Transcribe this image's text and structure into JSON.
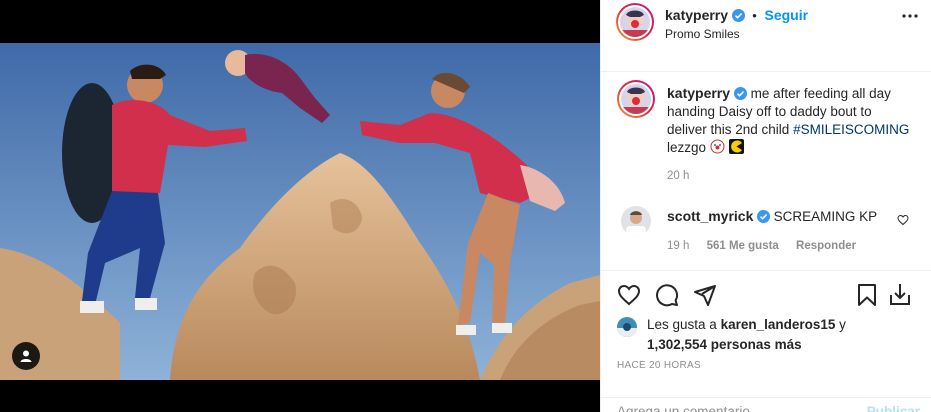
{
  "post": {
    "author": "katyperry",
    "follow_label": "Seguir",
    "dot": "•",
    "location": "Promo Smiles"
  },
  "caption": {
    "author": "katyperry",
    "text_before": "me after feeding all day handing Daisy off to daddy bout to deliver this 2nd child",
    "hashtag": "#SMILEISCOMING",
    "text_after": "lezzgo",
    "time": "20 h"
  },
  "comment": {
    "author": "scott_myrick",
    "text": "SCREAMING KP",
    "time": "19 h",
    "likes": "561 Me gusta",
    "reply_label": "Responder"
  },
  "likes": {
    "prefix": "Les gusta a",
    "user": "karen_landeros15",
    "joiner": "y",
    "others": "1,302,554 personas más"
  },
  "timestamp": "HACE 20 HORAS",
  "add_comment": {
    "placeholder": "Agrega un comentario...",
    "publish_label": "Publicar"
  },
  "icons": {
    "verified": "verified-badge-icon",
    "more": "more-options-icon",
    "like": "heart-icon",
    "comment": "comment-icon",
    "share": "share-icon",
    "save": "bookmark-icon",
    "download": "download-icon",
    "tag": "user-tag-icon"
  },
  "colors": {
    "accent": "#0095f6",
    "hashtag": "#00376b",
    "secondary": "#8e8e8e",
    "verified": "#3897f0"
  }
}
